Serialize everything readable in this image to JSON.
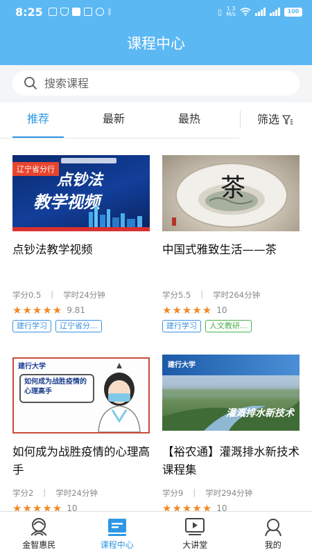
{
  "status": {
    "time": "8:25",
    "net_speed_top": "1.3",
    "net_speed_bottom": "M/s",
    "battery": "100"
  },
  "header": {
    "title": "课程中心"
  },
  "search": {
    "placeholder": "搜索课程"
  },
  "tabs": [
    {
      "label": "推荐",
      "active": true
    },
    {
      "label": "最新",
      "active": false
    },
    {
      "label": "最热",
      "active": false
    }
  ],
  "filter": {
    "label": "筛选"
  },
  "courses": [
    {
      "title": "点钞法教学视频",
      "thumb_badge": "辽宁省分行",
      "thumb_line1": "点钞法",
      "thumb_line2": "教学视频",
      "credit": "学分0.5",
      "hours": "学时24分钟",
      "score": "9.81",
      "rating": 5,
      "tags": [
        "建行学习",
        "辽宁省分..."
      ]
    },
    {
      "title": "中国式雅致生活——茶",
      "thumb_glyph": "茶",
      "credit": "学分5.5",
      "hours": "学时264分钟",
      "score": "10",
      "rating": 5,
      "tags": [
        "建行学习",
        "人文教研..."
      ]
    },
    {
      "title": "如何成为战胜疫情的心理高手",
      "thumb_brand": "建行大学",
      "thumb_text": "如何成为战胜疫情的心理高手",
      "credit": "学分2",
      "hours": "学时24分钟",
      "score": "10",
      "rating": 5
    },
    {
      "title": "【裕农通】灌溉排水新技术课程集",
      "thumb_brand": "建行大学",
      "thumb_text": "灌溉排水新技术",
      "credit": "学分9",
      "hours": "学时294分钟",
      "score": "10",
      "rating": 5
    }
  ],
  "bottom_nav": [
    {
      "label": "金智惠民",
      "icon": "jinzhi-logo-icon",
      "active": false
    },
    {
      "label": "课程中心",
      "icon": "course-book-icon",
      "active": true
    },
    {
      "label": "大讲堂",
      "icon": "video-play-icon",
      "active": false
    },
    {
      "label": "我的",
      "icon": "user-icon",
      "active": false
    }
  ],
  "colors": {
    "header_bg": "#5cb8f2",
    "accent": "#2f97e3",
    "star": "#f08a24",
    "tag_green": "#3da33d",
    "tag_blue": "#3a92e0"
  }
}
